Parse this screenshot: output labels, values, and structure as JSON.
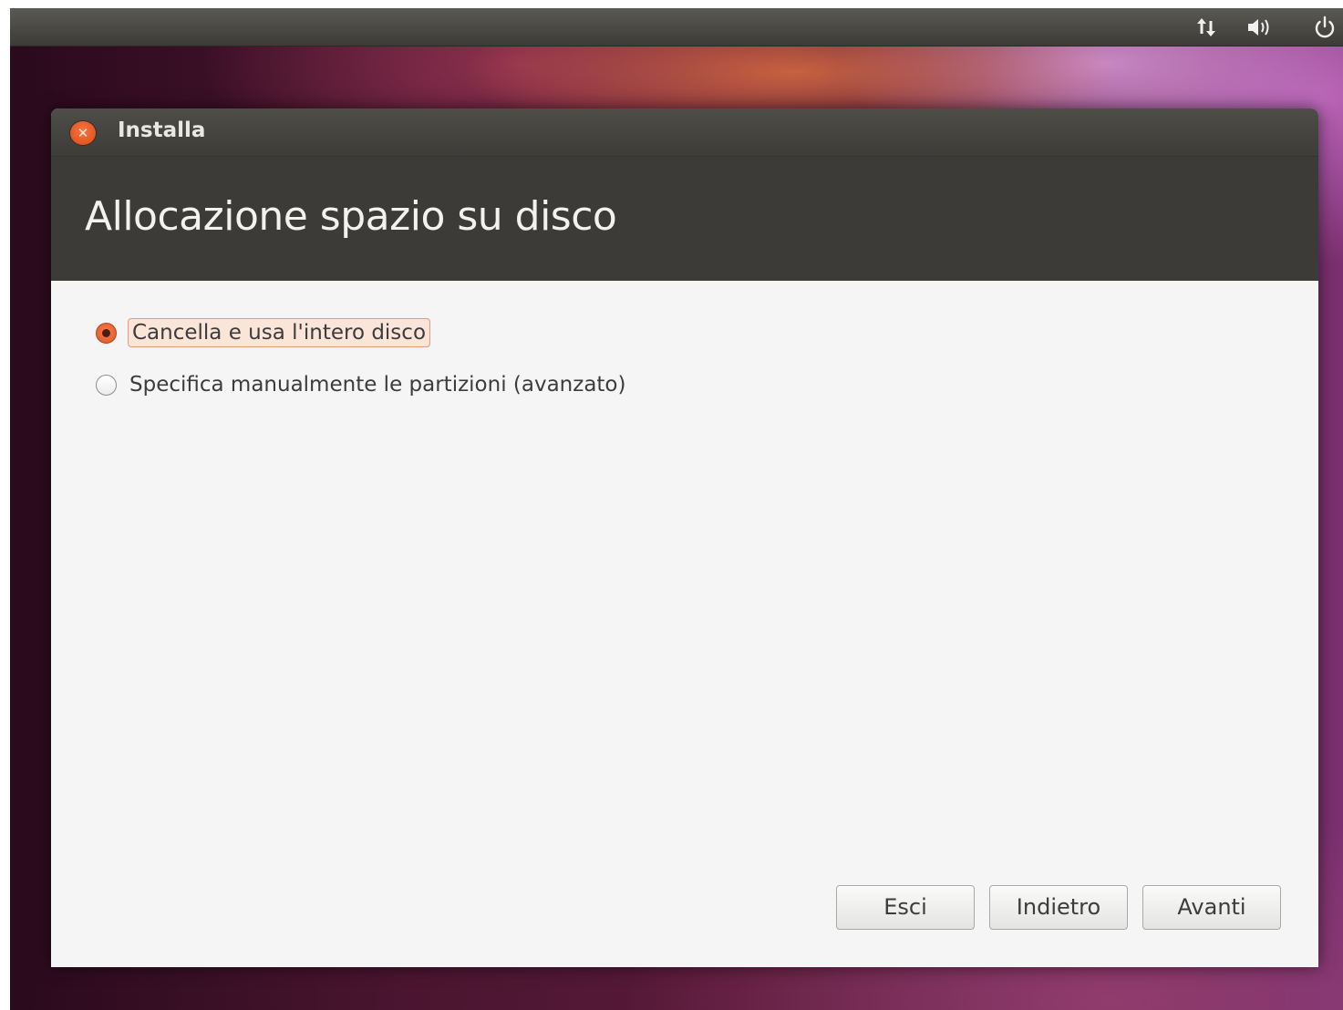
{
  "top_panel": {
    "icons": {
      "network": "network-updown-icon",
      "volume": "volume-icon",
      "power": "power-icon"
    }
  },
  "window": {
    "title": "Installa",
    "close_icon": "close-icon"
  },
  "page": {
    "title": "Allocazione spazio su disco"
  },
  "options": [
    {
      "label": "Cancella e usa l'intero disco",
      "selected": true
    },
    {
      "label": "Specifica manualmente le partizioni (avanzato)",
      "selected": false
    }
  ],
  "buttons": {
    "quit": "Esci",
    "back": "Indietro",
    "forward": "Avanti"
  },
  "colors": {
    "accent": "#dd4814",
    "header_bg": "#3c3b37",
    "content_bg": "#f5f5f5"
  }
}
